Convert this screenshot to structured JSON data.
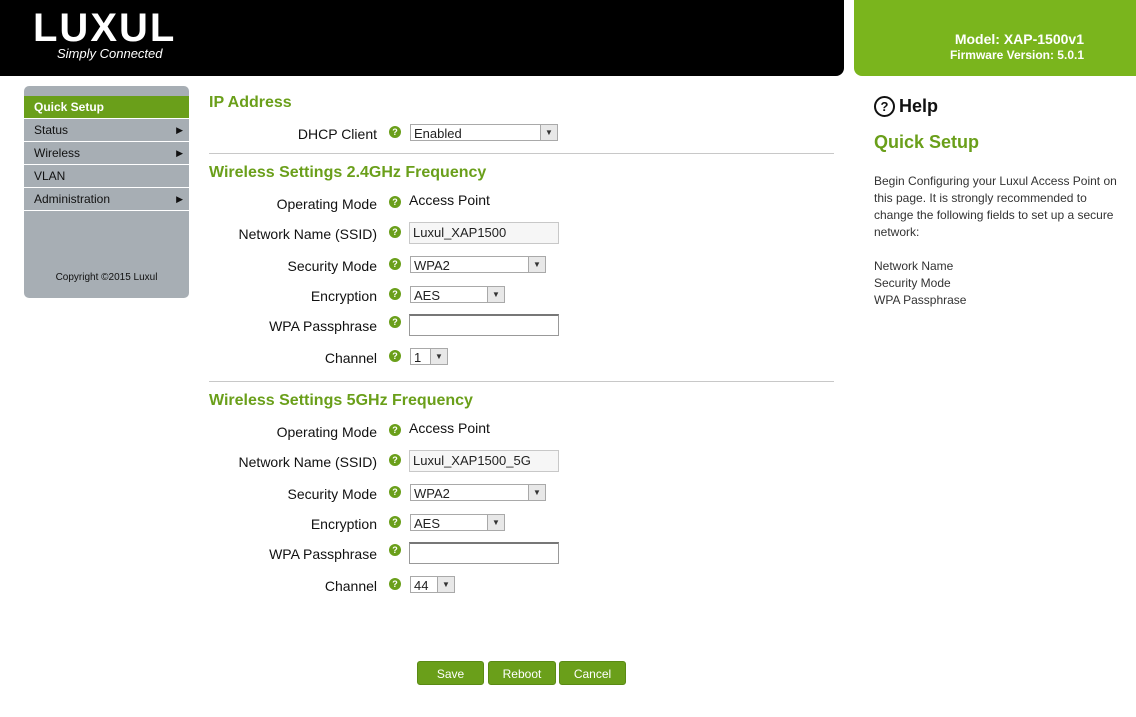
{
  "header": {
    "logo_text": "LUXUL",
    "tagline": "Simply Connected",
    "model": "Model: XAP-1500v1",
    "firmware": "Firmware Version: 5.0.1"
  },
  "sidebar": {
    "items": [
      {
        "label": "Quick Setup",
        "active": true
      },
      {
        "label": "Status",
        "submenu": true
      },
      {
        "label": "Wireless",
        "submenu": true
      },
      {
        "label": "VLAN"
      },
      {
        "label": "Administration",
        "submenu": true
      }
    ],
    "copyright": "Copyright ©2015 Luxul"
  },
  "ip": {
    "title": "IP Address",
    "dhcp_label": "DHCP Client",
    "dhcp_value": "Enabled"
  },
  "w24": {
    "title": "Wireless Settings 2.4GHz Frequency",
    "mode_label": "Operating Mode",
    "mode_value": "Access Point",
    "ssid_label": "Network Name (SSID)",
    "ssid_value": "Luxul_XAP1500",
    "security_label": "Security Mode",
    "security_value": "WPA2",
    "encryption_label": "Encryption",
    "encryption_value": "AES",
    "pass_label": "WPA Passphrase",
    "channel_label": "Channel",
    "channel_value": "1"
  },
  "w5": {
    "title": "Wireless Settings 5GHz Frequency",
    "mode_label": "Operating Mode",
    "mode_value": "Access Point",
    "ssid_label": "Network Name (SSID)",
    "ssid_value": "Luxul_XAP1500_5G",
    "security_label": "Security Mode",
    "security_value": "WPA2",
    "encryption_label": "Encryption",
    "encryption_value": "AES",
    "pass_label": "WPA Passphrase",
    "channel_label": "Channel",
    "channel_value": "44"
  },
  "buttons": {
    "save": "Save",
    "reboot": "Reboot",
    "cancel": "Cancel"
  },
  "help": {
    "title": "Help",
    "subtitle": "Quick Setup",
    "body": "Begin Configuring your Luxul Access Point on this page. It is strongly recommended to change the following fields to set up a secure network:",
    "fields": [
      "Network Name",
      "Security Mode",
      "WPA Passphrase"
    ]
  },
  "icons": {
    "help_question": "question-circle-icon",
    "submenu_arrow": "triangle-right-icon",
    "dropdown_arrow": "chevron-down-icon"
  },
  "colors": {
    "brand_green": "#7ab51d",
    "accent_green": "#6a9f1a",
    "header_black": "#000000",
    "sidebar_gray": "#a7aeb4"
  }
}
